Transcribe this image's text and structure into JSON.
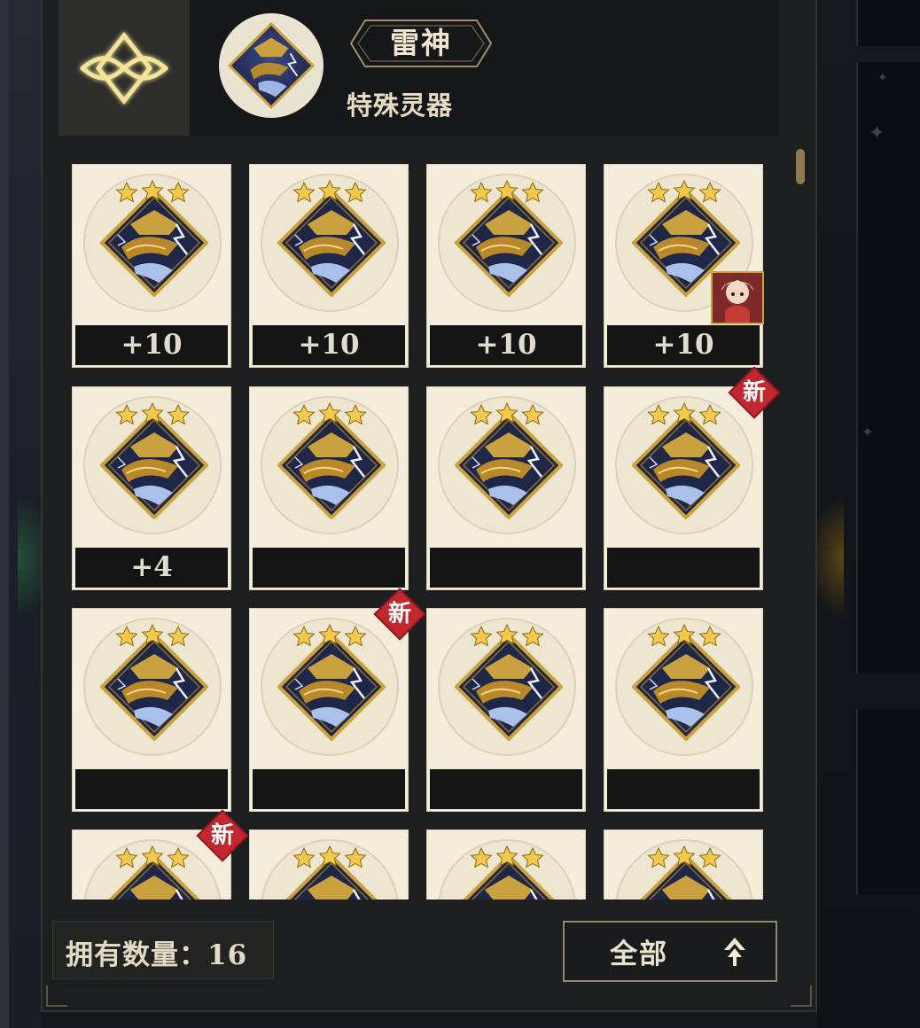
{
  "header": {
    "title": "雷神",
    "subtitle": "特殊灵器",
    "back_icon": "ornate-diamond-emblem-icon",
    "portrait_icon": "thunder-god-portrait-icon"
  },
  "colors": {
    "panel_bg": "#1d1e20",
    "card_bg": "#f4eddc",
    "new_badge": "#c2272f",
    "gold": "#d4b24a"
  },
  "grid": {
    "items": [
      {
        "level": "+10",
        "stars": 3,
        "is_new": false,
        "equipped": false
      },
      {
        "level": "+10",
        "stars": 3,
        "is_new": false,
        "equipped": false
      },
      {
        "level": "+10",
        "stars": 3,
        "is_new": false,
        "equipped": false
      },
      {
        "level": "+10",
        "stars": 3,
        "is_new": false,
        "equipped": true
      },
      {
        "level": "+4",
        "stars": 3,
        "is_new": false,
        "equipped": false
      },
      {
        "level": "",
        "stars": 3,
        "is_new": false,
        "equipped": false
      },
      {
        "level": "",
        "stars": 3,
        "is_new": false,
        "equipped": false
      },
      {
        "level": "",
        "stars": 3,
        "is_new": true,
        "equipped": false
      },
      {
        "level": "",
        "stars": 3,
        "is_new": false,
        "equipped": false
      },
      {
        "level": "",
        "stars": 3,
        "is_new": true,
        "equipped": false
      },
      {
        "level": "",
        "stars": 3,
        "is_new": false,
        "equipped": false
      },
      {
        "level": "",
        "stars": 3,
        "is_new": false,
        "equipped": false
      },
      {
        "level": "",
        "stars": 3,
        "is_new": true,
        "equipped": false
      },
      {
        "level": "",
        "stars": 3,
        "is_new": false,
        "equipped": false
      },
      {
        "level": "",
        "stars": 3,
        "is_new": false,
        "equipped": false
      },
      {
        "level": "",
        "stars": 3,
        "is_new": false,
        "equipped": false
      }
    ],
    "new_label": "新"
  },
  "footer": {
    "owned_label": "拥有数量：16",
    "filter_label": "全部",
    "filter_icon": "chevron-up-icon"
  }
}
